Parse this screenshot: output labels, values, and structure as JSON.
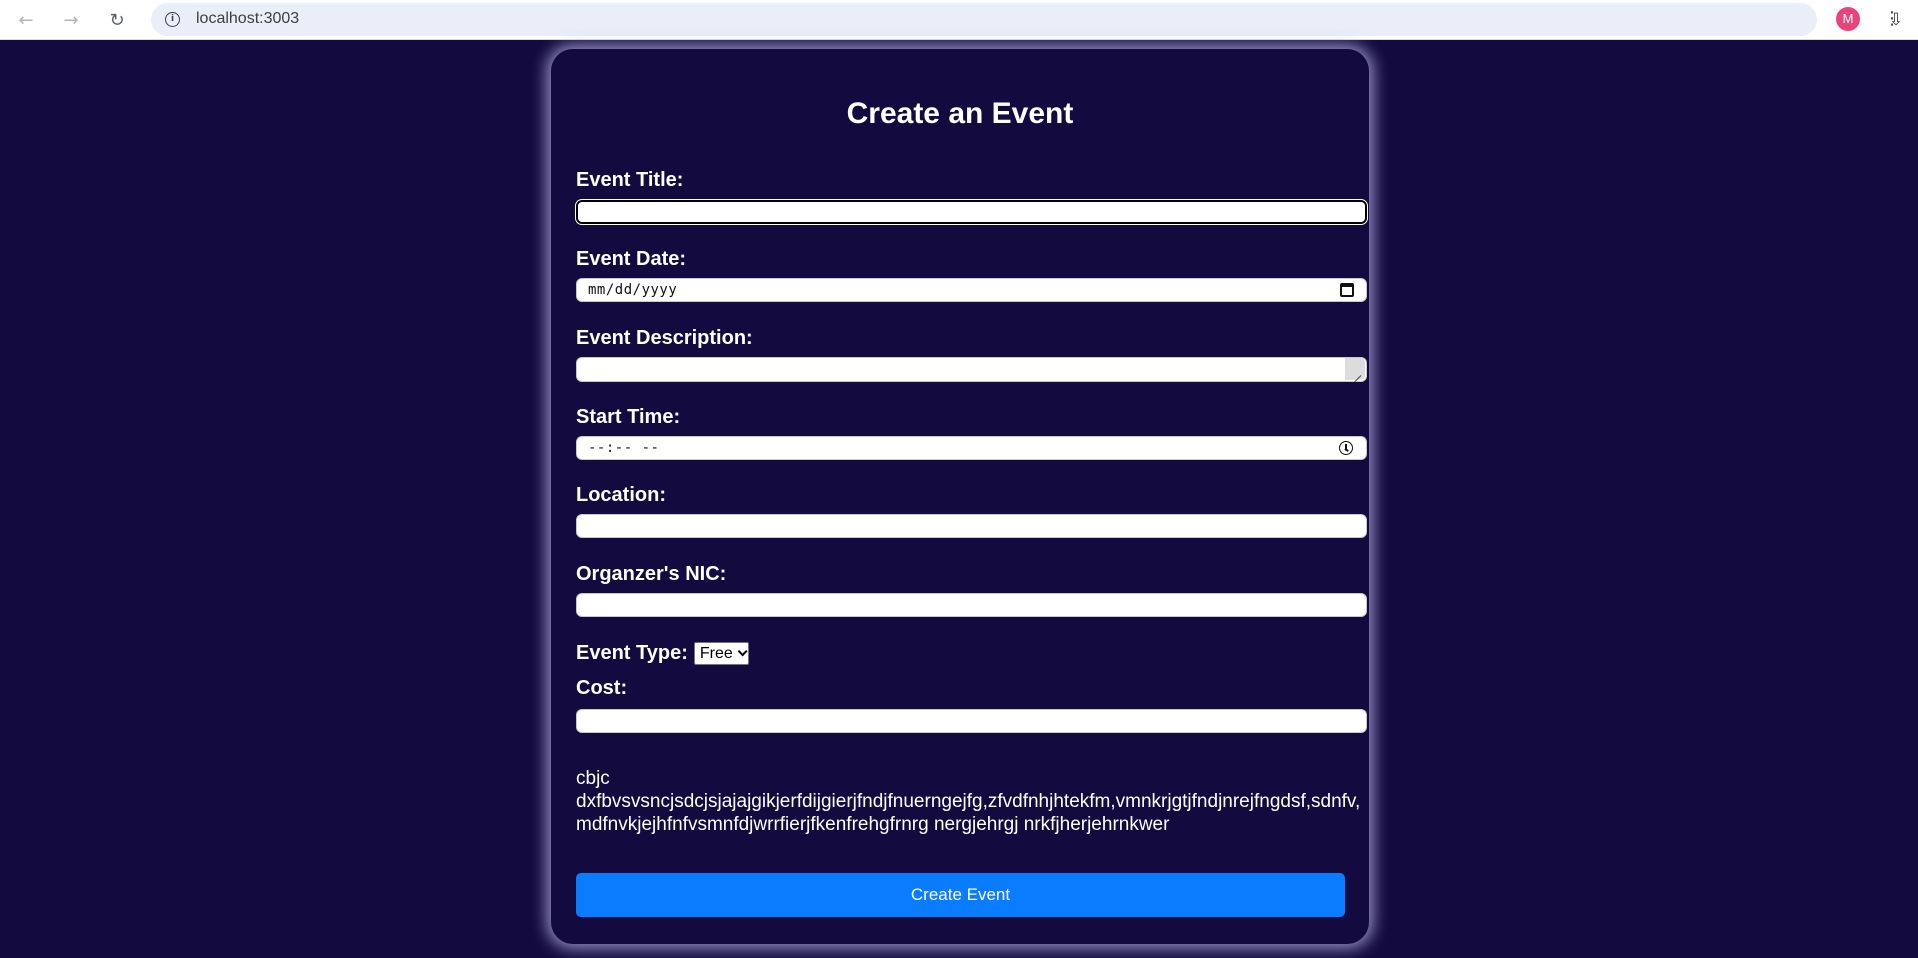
{
  "browser": {
    "url": "localhost:3003",
    "back_icon": "←",
    "forward_icon": "→",
    "reload_icon": "↻",
    "info_icon": "i",
    "install_icon": "⇩",
    "star_icon": "☆",
    "avatar_letter": "M",
    "menu_icon": "⋮"
  },
  "form": {
    "title": "Create an Event",
    "event_title_label": "Event Title:",
    "event_title_value": "",
    "event_date_label": "Event Date:",
    "event_date_placeholder": "mm/dd/yyyy",
    "event_description_label": "Event Description:",
    "event_description_value": "",
    "start_time_label": "Start Time:",
    "start_time_placeholder": "--:-- --",
    "location_label": "Location:",
    "location_value": "",
    "nic_label": "Organzer's NIC:",
    "nic_value": "",
    "event_type_label": "Event Type:",
    "event_type_selected": "Free",
    "cost_label": "Cost:",
    "cost_value": "",
    "description_text": "cbjc dxfbvsvsncjsdcjsjajajgikjerfdijgierjfndjfnuerngejfg,zfvdfnhjhtekfm,vmnkrjgtjfndjnrejfngdsf,sdnfv,mdfnvkjejhfnfvsmnfdjwrrfierjfkenfrehgfrnrg nergjehrgj nrkfjherjehrnkwer",
    "submit_label": "Create Event"
  },
  "colors": {
    "background": "#130b3f",
    "button": "#0a7cff",
    "avatar": "#e8437a"
  }
}
